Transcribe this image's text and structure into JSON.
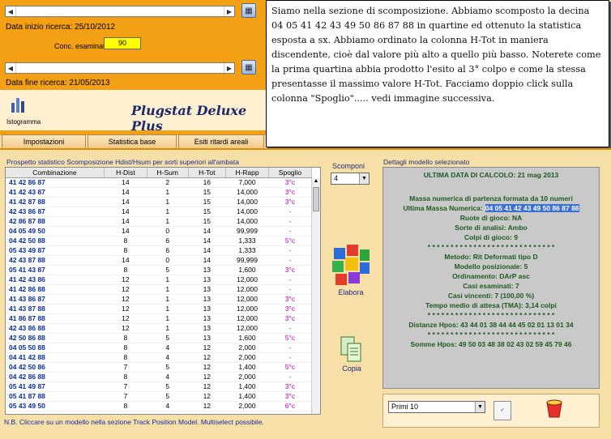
{
  "top": {
    "data_inizio_label": "Data inizio ricerca: 25/10/2012",
    "conc_label": "Conc. esaminati",
    "conc_value": "90",
    "data_fine_label": "Data fine ricerca: 21/05/2013",
    "istogramma_label": "Istogramma",
    "app_title": "Plugstat Deluxe Plus"
  },
  "note_text": "Siamo nella sezione di scomposizione. Abbiamo scomposto la decina 04 05 41 42 43 49 50 86 87 88 in quartine ed ottenuto la statistica esposta a sx. Abbiamo ordinato la colonna H-Tot in maniera discendente, cioè dal valore più alto a quello più basso. Noterete come la prima quartina abbia prodotto l'esito al 3° colpo e come la stessa presentasse il massimo valore H-Tot. Facciamo doppio click sulla colonna \"Spoglio\"..... vedi immagine successiva.",
  "tabs": [
    "Impostazioni",
    "Statistica base",
    "Esiti ritardi areali"
  ],
  "grid": {
    "title": "Prospetto statistico Scomposizione Hdist/Hsum per sorti superiori all'ambata",
    "columns": [
      "Combinazione",
      "H-Dist",
      "H-Sum",
      "H-Tot",
      "H-Rapp",
      "Spoglio"
    ],
    "rows": [
      [
        "41 42 86 87",
        "14",
        "2",
        "16",
        "7,000",
        "3°c"
      ],
      [
        "41 42 43 87",
        "14",
        "1",
        "15",
        "14,000",
        "3°c"
      ],
      [
        "41 42 87 88",
        "14",
        "1",
        "15",
        "14,000",
        "3°c"
      ],
      [
        "42 43 86 87",
        "14",
        "1",
        "15",
        "14,000",
        "-"
      ],
      [
        "42 86 87 88",
        "14",
        "1",
        "15",
        "14,000",
        "-"
      ],
      [
        "04 05 49 50",
        "14",
        "0",
        "14",
        "99,999",
        "-"
      ],
      [
        "04 42 50 88",
        "8",
        "6",
        "14",
        "1,333",
        "5°c"
      ],
      [
        "05 43 49 87",
        "8",
        "6",
        "14",
        "1,333",
        "-"
      ],
      [
        "42 43 87 88",
        "14",
        "0",
        "14",
        "99,999",
        "-"
      ],
      [
        "05 41 43 87",
        "8",
        "5",
        "13",
        "1,600",
        "3°c"
      ],
      [
        "41 42 43 86",
        "12",
        "1",
        "13",
        "12,000",
        "-"
      ],
      [
        "41 42 86 88",
        "12",
        "1",
        "13",
        "12,000",
        "-"
      ],
      [
        "41 43 86 87",
        "12",
        "1",
        "13",
        "12,000",
        "3°c"
      ],
      [
        "41 43 87 88",
        "12",
        "1",
        "13",
        "12,000",
        "3°c"
      ],
      [
        "41 86 87 88",
        "12",
        "1",
        "13",
        "12,000",
        "3°c"
      ],
      [
        "42 43 86 88",
        "12",
        "1",
        "13",
        "12,000",
        "-"
      ],
      [
        "42 50 86 88",
        "8",
        "5",
        "13",
        "1,600",
        "5°c"
      ],
      [
        "04 05 50 88",
        "8",
        "4",
        "12",
        "2,000",
        "-"
      ],
      [
        "04 41 42 88",
        "8",
        "4",
        "12",
        "2,000",
        "-"
      ],
      [
        "04 42 50 86",
        "7",
        "5",
        "12",
        "1,400",
        "5°c"
      ],
      [
        "04 42 86 88",
        "8",
        "4",
        "12",
        "2,000",
        "-"
      ],
      [
        "05 41 49 87",
        "7",
        "5",
        "12",
        "1,400",
        "3°c"
      ],
      [
        "05 41 87 88",
        "7",
        "5",
        "12",
        "1,400",
        "3°c"
      ],
      [
        "05 43 49 50",
        "8",
        "4",
        "12",
        "2,000",
        "6°c"
      ]
    ]
  },
  "footer_note": "N.B. Cliccare su un modello nella sezione Track Position Model. Multiselect possibile.",
  "scomponi": {
    "label": "Scomponi",
    "value": "4"
  },
  "elabora_label": "Elabora",
  "copia_label": "Copia",
  "details": {
    "header": "Dettagli modello selezionato",
    "lines": [
      "ULTIMA DATA DI CALCOLO: 21 mag 2013",
      "",
      "Massa numerica di partenza formata da 10 numeri",
      "Ultima Massa Numerica:",
      "Ruote di gioco: NA",
      "Sorte di analisi: Ambo",
      "Colpi di gioco: 9",
      "* * * * * * * * * * * * * * * * * * * * * * * * * * * *",
      "Metodo: Rit Deformati tipo D",
      "Modello posizionale: 5",
      "Ordinamento: DArP asc",
      "Casi esaminati: 7",
      "Casi vincenti: 7 (100,00 %)",
      "Tempo medio di attesa (TMA):  3,14 colpi",
      "* * * * * * * * * * * * * * * * * * * * * * * * * * * *",
      "Distanze Hpos: 43 44 01 38 44 44 45 02 01 13 01 34",
      "* * * * * * * * * * * * * * * * * * * * * * * * * * * *",
      "Somme Hpos: 49 50 03 48 38 02 43 02 59 45 79 46"
    ],
    "massa_highlight": "04 05 41 42 43 49 50 86 87 88"
  },
  "primi": {
    "value": "Primi 10"
  }
}
